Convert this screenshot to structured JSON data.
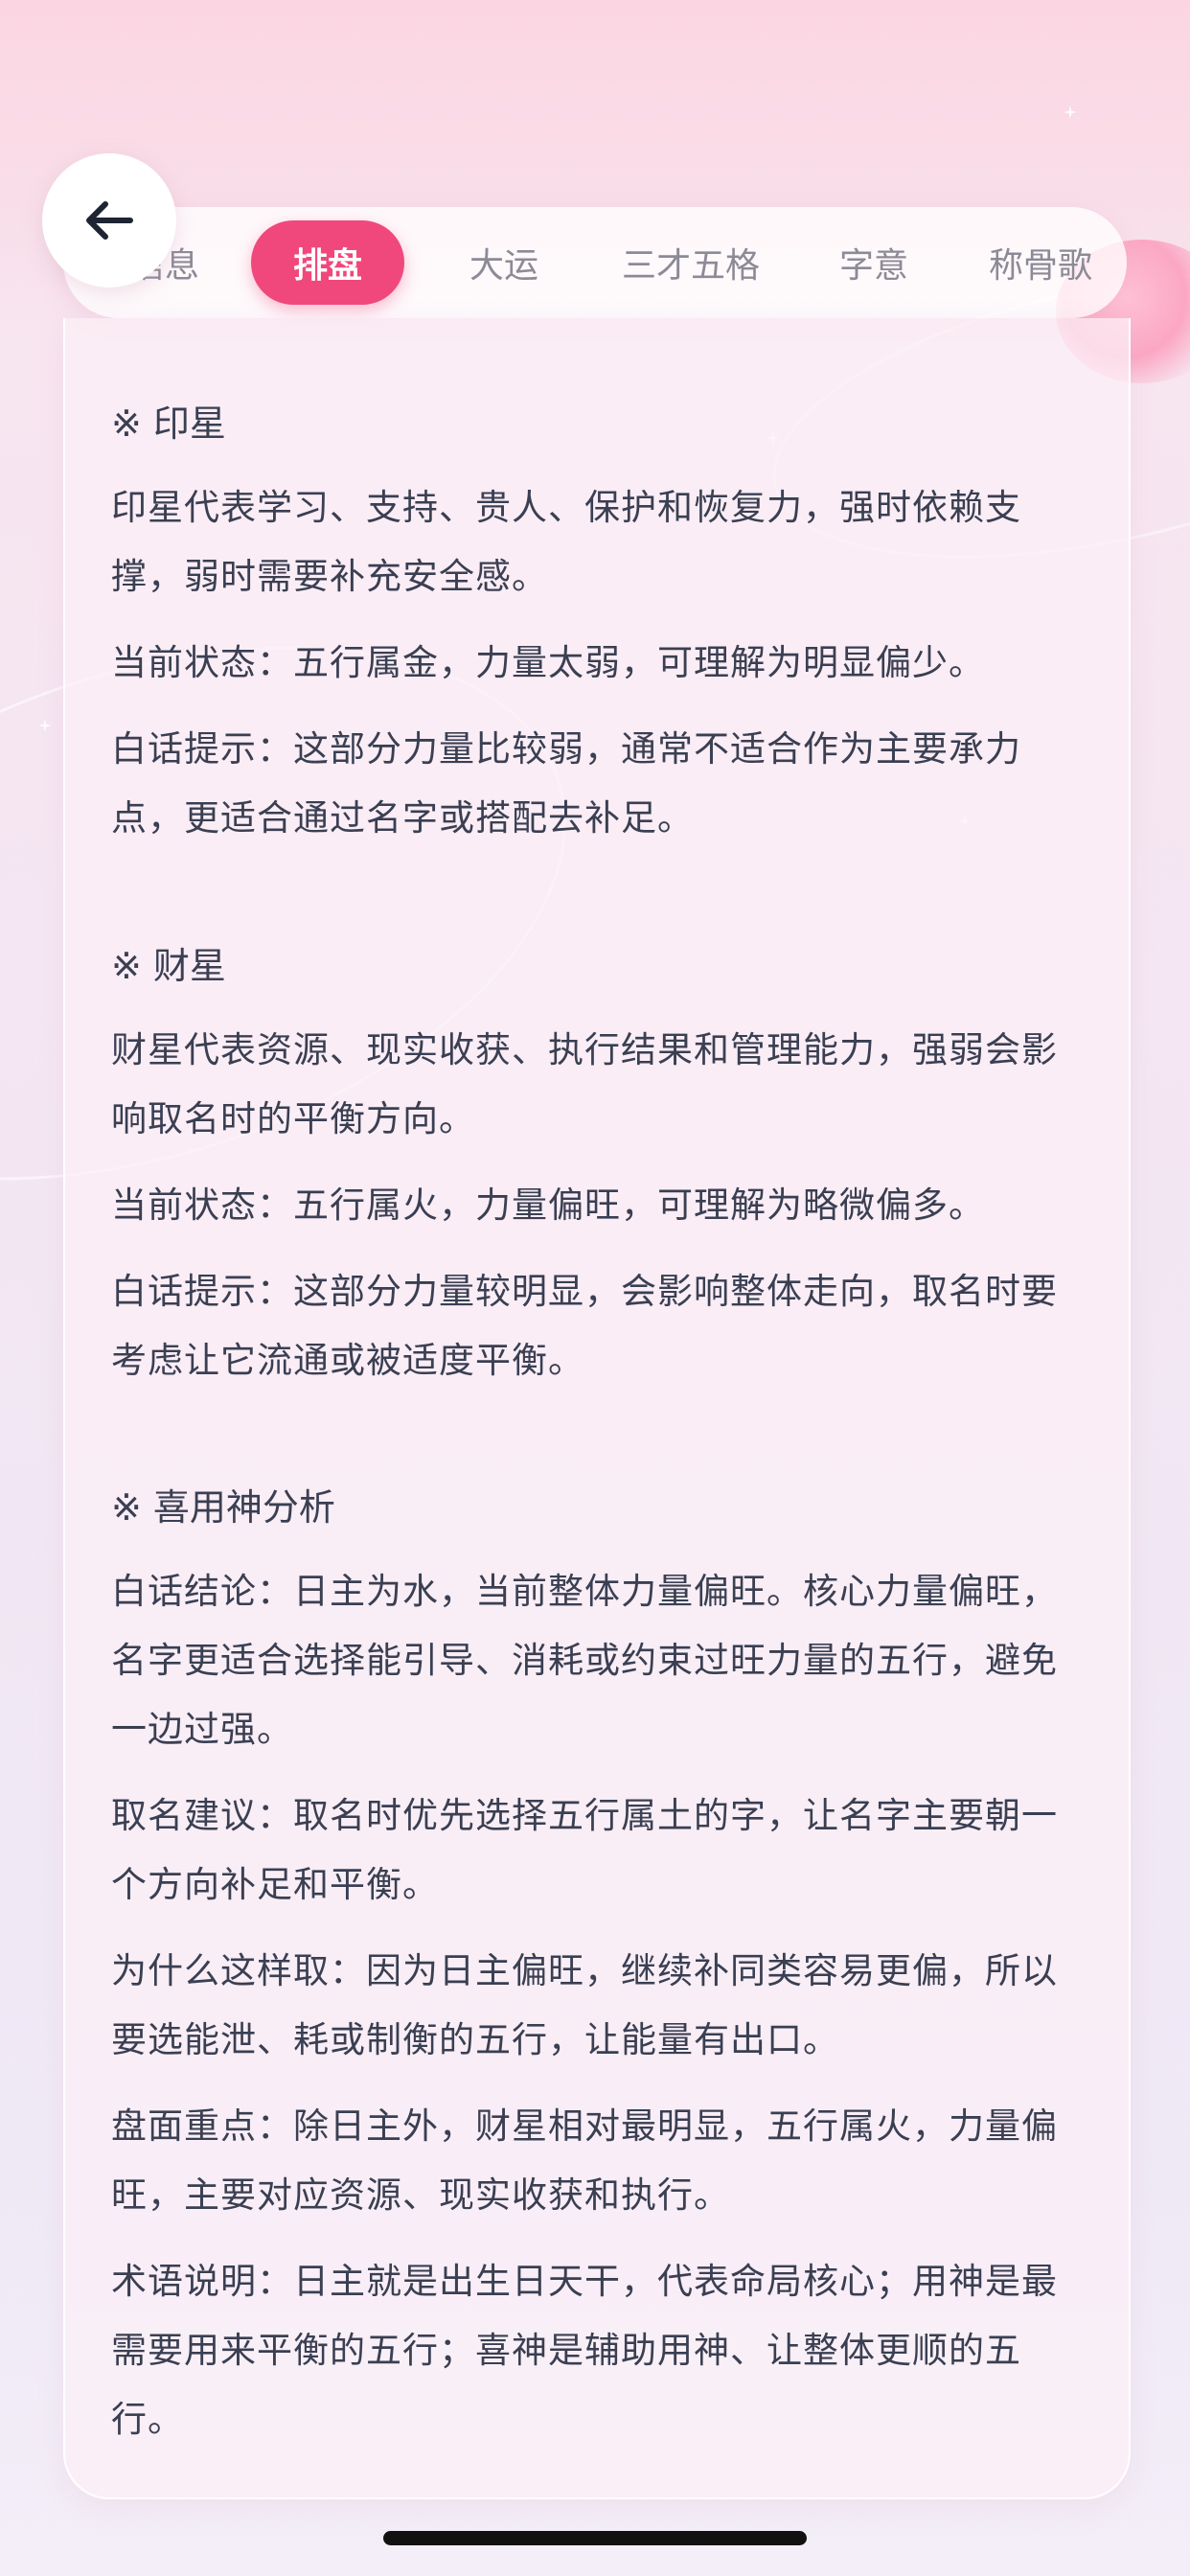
{
  "tabs": [
    {
      "label": "信息",
      "active": false
    },
    {
      "label": "排盘",
      "active": true
    },
    {
      "label": "大运",
      "active": false
    },
    {
      "label": "三才五格",
      "active": false
    },
    {
      "label": "字意",
      "active": false
    },
    {
      "label": "称骨歌",
      "active": false
    }
  ],
  "sections": [
    {
      "title": "※ 印星",
      "paragraphs": [
        "印星代表学习、支持、贵人、保护和恢复力，强时依赖支撑，弱时需要补充安全感。",
        "当前状态：五行属金，力量太弱，可理解为明显偏少。",
        "白话提示：这部分力量比较弱，通常不适合作为主要承力点，更适合通过名字或搭配去补足。"
      ]
    },
    {
      "title": "※ 财星",
      "paragraphs": [
        "财星代表资源、现实收获、执行结果和管理能力，强弱会影响取名时的平衡方向。",
        "当前状态：五行属火，力量偏旺，可理解为略微偏多。",
        "白话提示：这部分力量较明显，会影响整体走向，取名时要考虑让它流通或被适度平衡。"
      ]
    },
    {
      "title": "※ 喜用神分析",
      "paragraphs": [
        "白话结论：日主为水，当前整体力量偏旺。核心力量偏旺，名字更适合选择能引导、消耗或约束过旺力量的五行，避免一边过强。",
        "取名建议：取名时优先选择五行属土的字，让名字主要朝一个方向补足和平衡。",
        "为什么这样取：因为日主偏旺，继续补同类容易更偏，所以要选能泄、耗或制衡的五行，让能量有出口。",
        "盘面重点：除日主外，财星相对最明显，五行属火，力量偏旺，主要对应资源、现实收获和执行。",
        "术语说明：日主就是出生日天干，代表命局核心；用神是最需要用来平衡的五行；喜神是辅助用神、让整体更顺的五行。"
      ]
    }
  ],
  "icons": {
    "back": "arrow-left-icon"
  },
  "colors": {
    "accent": "#f0487d",
    "text": "#3a3f52",
    "tab_inactive": "#8d8a97"
  }
}
